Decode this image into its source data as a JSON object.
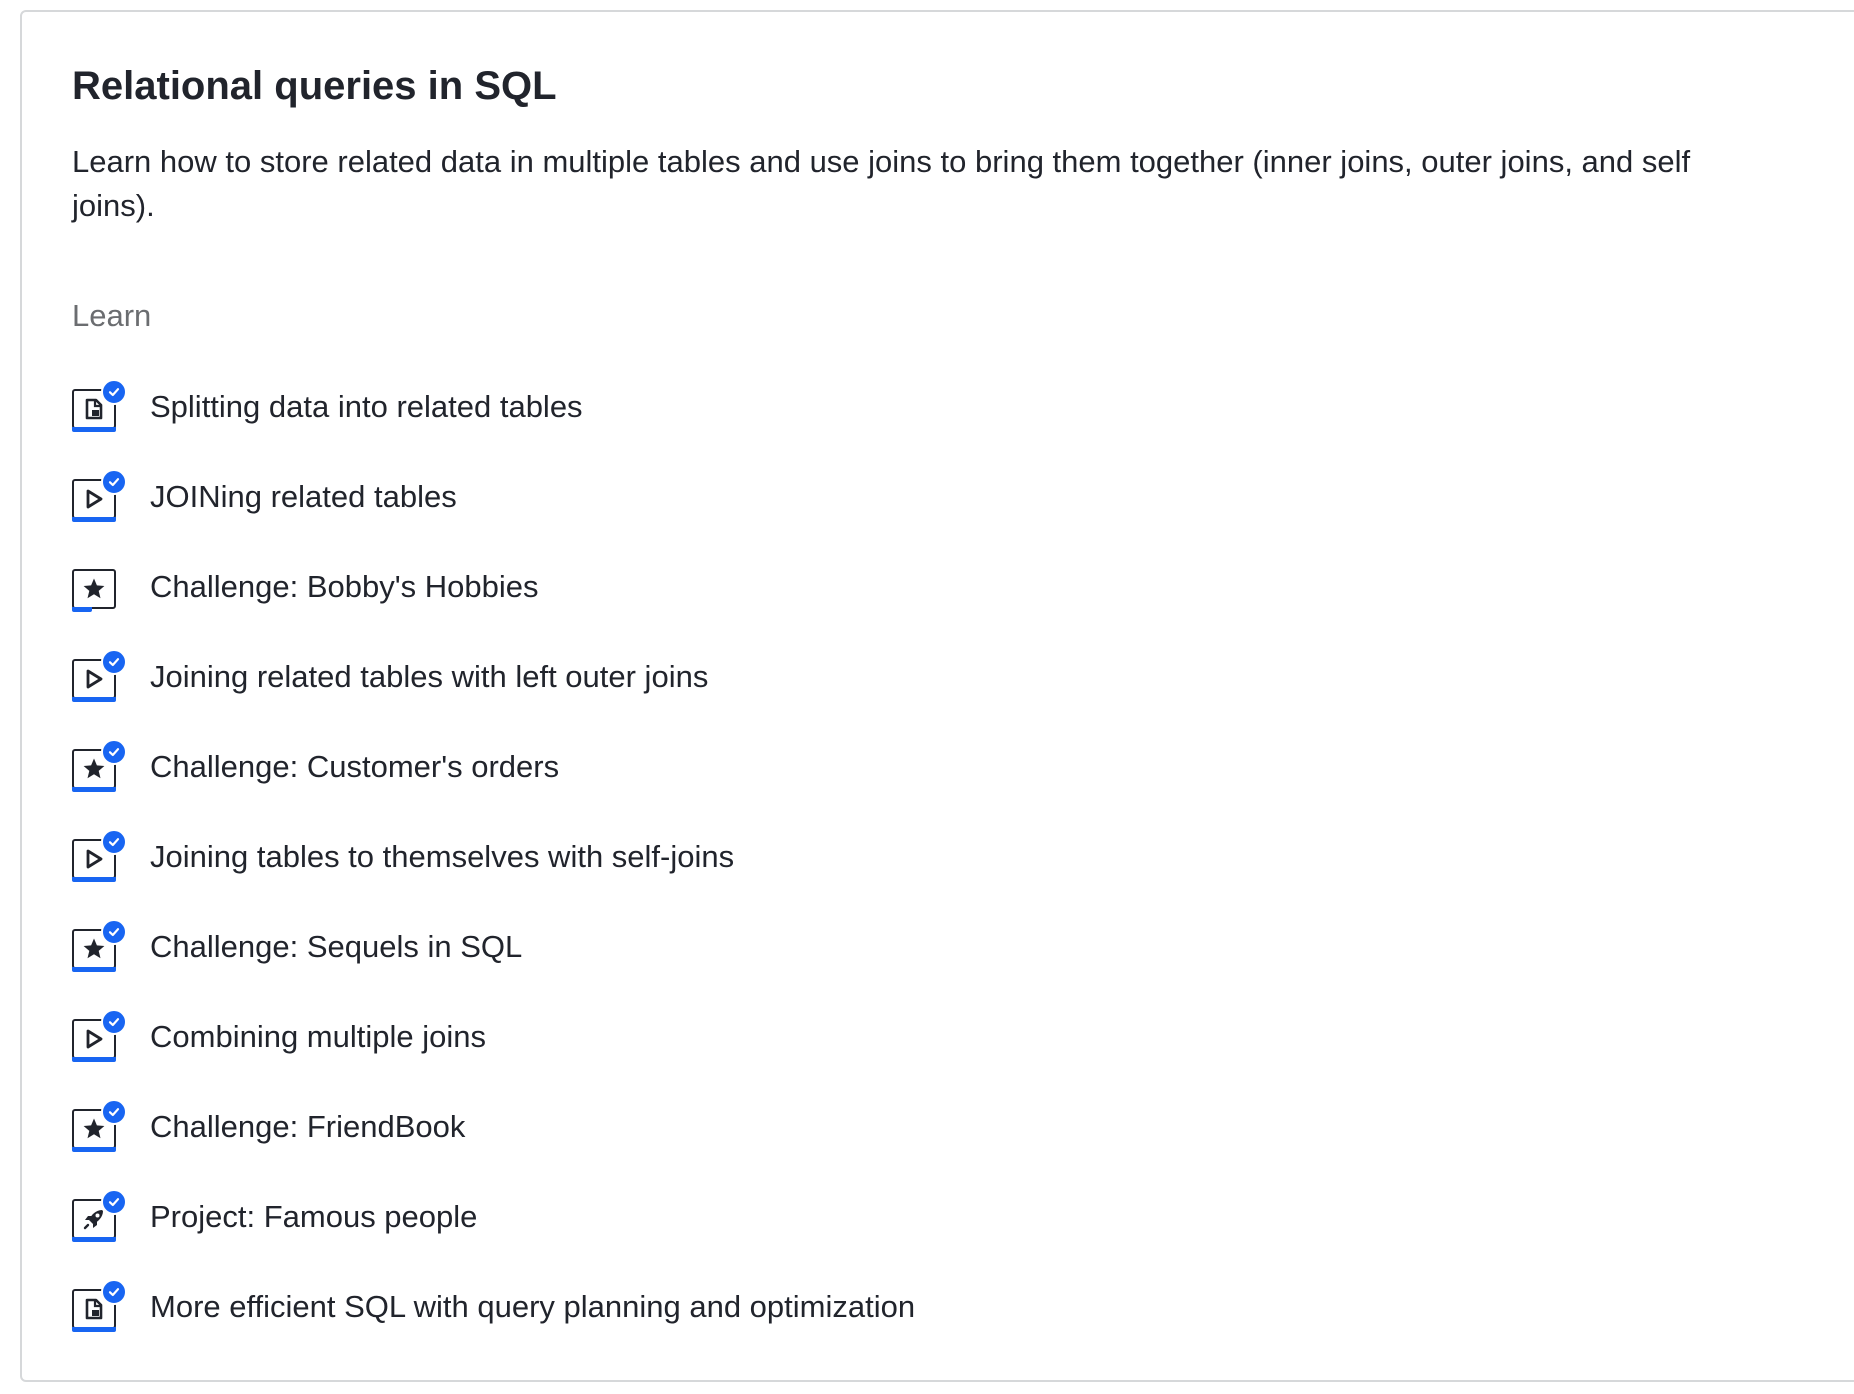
{
  "unit": {
    "title": "Relational queries in SQL",
    "description": "Learn how to store related data in multiple tables and use joins to bring them together (inner joins, outer joins, and self joins).",
    "section_label": "Learn"
  },
  "colors": {
    "accent": "#1865f2",
    "text": "#21242c",
    "muted": "#6b6d70",
    "border": "#d6d8da"
  },
  "items": [
    {
      "label": "Splitting data into related tables",
      "icon": "article-icon",
      "completed": true,
      "progress": 1.0
    },
    {
      "label": "JOINing related tables",
      "icon": "video-icon",
      "completed": true,
      "progress": 1.0
    },
    {
      "label": "Challenge: Bobby's Hobbies",
      "icon": "challenge-star-icon",
      "completed": false,
      "progress": 0.45
    },
    {
      "label": "Joining related tables with left outer joins",
      "icon": "video-icon",
      "completed": true,
      "progress": 1.0
    },
    {
      "label": "Challenge: Customer's orders",
      "icon": "challenge-star-icon",
      "completed": true,
      "progress": 1.0
    },
    {
      "label": "Joining tables to themselves with self-joins",
      "icon": "video-icon",
      "completed": true,
      "progress": 1.0
    },
    {
      "label": "Challenge: Sequels in SQL",
      "icon": "challenge-star-icon",
      "completed": true,
      "progress": 1.0
    },
    {
      "label": "Combining multiple joins",
      "icon": "video-icon",
      "completed": true,
      "progress": 1.0
    },
    {
      "label": "Challenge: FriendBook",
      "icon": "challenge-star-icon",
      "completed": true,
      "progress": 1.0
    },
    {
      "label": "Project: Famous people",
      "icon": "project-rocket-icon",
      "completed": true,
      "progress": 1.0
    },
    {
      "label": "More efficient SQL with query planning and optimization",
      "icon": "article-icon",
      "completed": true,
      "progress": 1.0
    }
  ]
}
